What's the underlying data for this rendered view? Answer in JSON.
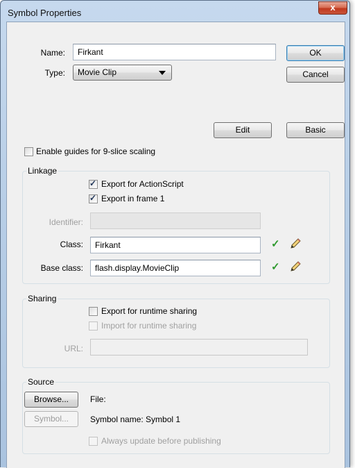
{
  "window": {
    "title": "Symbol Properties",
    "close_glyph": "x"
  },
  "form": {
    "name_label": "Name:",
    "name_value": "Firkant",
    "type_label": "Type:",
    "type_value": "Movie Clip"
  },
  "buttons": {
    "ok": "OK",
    "cancel": "Cancel",
    "edit": "Edit",
    "basic": "Basic",
    "browse": "Browse...",
    "symbol": "Symbol..."
  },
  "guides": {
    "label": "Enable guides for 9-slice scaling",
    "checked": false
  },
  "linkage": {
    "title": "Linkage",
    "export_as": {
      "label": "Export for ActionScript",
      "checked": true
    },
    "export_frame1": {
      "label": "Export in frame 1",
      "checked": true
    },
    "identifier_label": "Identifier:",
    "identifier_value": "",
    "class_label": "Class:",
    "class_value": "Firkant",
    "base_class_label": "Base class:",
    "base_class_value": "flash.display.MovieClip",
    "valid_icon": "checkmark-icon",
    "edit_icon": "pencil-icon"
  },
  "sharing": {
    "title": "Sharing",
    "export_runtime": {
      "label": "Export for runtime sharing",
      "checked": false
    },
    "import_runtime": {
      "label": "Import for runtime sharing",
      "checked": false
    },
    "url_label": "URL:",
    "url_value": ""
  },
  "source": {
    "title": "Source",
    "file_label": "File:",
    "symbol_name": "Symbol name: Symbol 1",
    "always_update": {
      "label": "Always update before publishing",
      "checked": false
    }
  },
  "colors": {
    "accent": "#3c7fb1",
    "valid": "#2f9a2f",
    "close": "#c0391e"
  }
}
